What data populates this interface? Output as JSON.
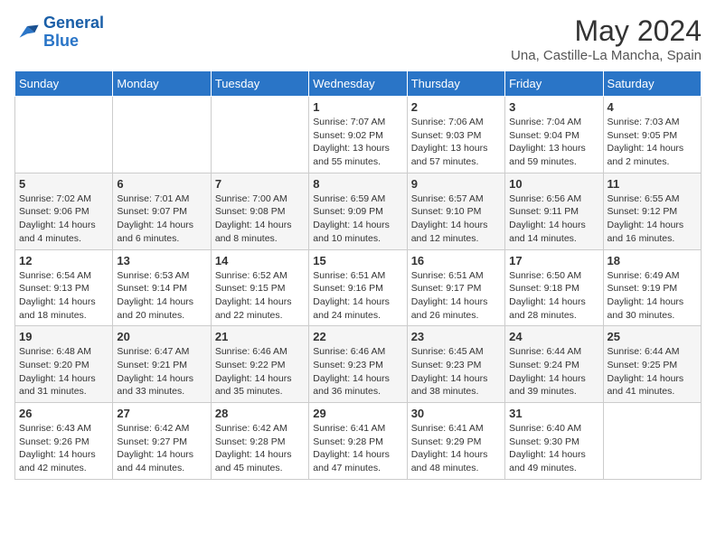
{
  "header": {
    "logo_line1": "General",
    "logo_line2": "Blue",
    "title": "May 2024",
    "subtitle": "Una, Castille-La Mancha, Spain"
  },
  "weekdays": [
    "Sunday",
    "Monday",
    "Tuesday",
    "Wednesday",
    "Thursday",
    "Friday",
    "Saturday"
  ],
  "weeks": [
    [
      {
        "day": "",
        "info": ""
      },
      {
        "day": "",
        "info": ""
      },
      {
        "day": "",
        "info": ""
      },
      {
        "day": "1",
        "info": "Sunrise: 7:07 AM\nSunset: 9:02 PM\nDaylight: 13 hours\nand 55 minutes."
      },
      {
        "day": "2",
        "info": "Sunrise: 7:06 AM\nSunset: 9:03 PM\nDaylight: 13 hours\nand 57 minutes."
      },
      {
        "day": "3",
        "info": "Sunrise: 7:04 AM\nSunset: 9:04 PM\nDaylight: 13 hours\nand 59 minutes."
      },
      {
        "day": "4",
        "info": "Sunrise: 7:03 AM\nSunset: 9:05 PM\nDaylight: 14 hours\nand 2 minutes."
      }
    ],
    [
      {
        "day": "5",
        "info": "Sunrise: 7:02 AM\nSunset: 9:06 PM\nDaylight: 14 hours\nand 4 minutes."
      },
      {
        "day": "6",
        "info": "Sunrise: 7:01 AM\nSunset: 9:07 PM\nDaylight: 14 hours\nand 6 minutes."
      },
      {
        "day": "7",
        "info": "Sunrise: 7:00 AM\nSunset: 9:08 PM\nDaylight: 14 hours\nand 8 minutes."
      },
      {
        "day": "8",
        "info": "Sunrise: 6:59 AM\nSunset: 9:09 PM\nDaylight: 14 hours\nand 10 minutes."
      },
      {
        "day": "9",
        "info": "Sunrise: 6:57 AM\nSunset: 9:10 PM\nDaylight: 14 hours\nand 12 minutes."
      },
      {
        "day": "10",
        "info": "Sunrise: 6:56 AM\nSunset: 9:11 PM\nDaylight: 14 hours\nand 14 minutes."
      },
      {
        "day": "11",
        "info": "Sunrise: 6:55 AM\nSunset: 9:12 PM\nDaylight: 14 hours\nand 16 minutes."
      }
    ],
    [
      {
        "day": "12",
        "info": "Sunrise: 6:54 AM\nSunset: 9:13 PM\nDaylight: 14 hours\nand 18 minutes."
      },
      {
        "day": "13",
        "info": "Sunrise: 6:53 AM\nSunset: 9:14 PM\nDaylight: 14 hours\nand 20 minutes."
      },
      {
        "day": "14",
        "info": "Sunrise: 6:52 AM\nSunset: 9:15 PM\nDaylight: 14 hours\nand 22 minutes."
      },
      {
        "day": "15",
        "info": "Sunrise: 6:51 AM\nSunset: 9:16 PM\nDaylight: 14 hours\nand 24 minutes."
      },
      {
        "day": "16",
        "info": "Sunrise: 6:51 AM\nSunset: 9:17 PM\nDaylight: 14 hours\nand 26 minutes."
      },
      {
        "day": "17",
        "info": "Sunrise: 6:50 AM\nSunset: 9:18 PM\nDaylight: 14 hours\nand 28 minutes."
      },
      {
        "day": "18",
        "info": "Sunrise: 6:49 AM\nSunset: 9:19 PM\nDaylight: 14 hours\nand 30 minutes."
      }
    ],
    [
      {
        "day": "19",
        "info": "Sunrise: 6:48 AM\nSunset: 9:20 PM\nDaylight: 14 hours\nand 31 minutes."
      },
      {
        "day": "20",
        "info": "Sunrise: 6:47 AM\nSunset: 9:21 PM\nDaylight: 14 hours\nand 33 minutes."
      },
      {
        "day": "21",
        "info": "Sunrise: 6:46 AM\nSunset: 9:22 PM\nDaylight: 14 hours\nand 35 minutes."
      },
      {
        "day": "22",
        "info": "Sunrise: 6:46 AM\nSunset: 9:23 PM\nDaylight: 14 hours\nand 36 minutes."
      },
      {
        "day": "23",
        "info": "Sunrise: 6:45 AM\nSunset: 9:23 PM\nDaylight: 14 hours\nand 38 minutes."
      },
      {
        "day": "24",
        "info": "Sunrise: 6:44 AM\nSunset: 9:24 PM\nDaylight: 14 hours\nand 39 minutes."
      },
      {
        "day": "25",
        "info": "Sunrise: 6:44 AM\nSunset: 9:25 PM\nDaylight: 14 hours\nand 41 minutes."
      }
    ],
    [
      {
        "day": "26",
        "info": "Sunrise: 6:43 AM\nSunset: 9:26 PM\nDaylight: 14 hours\nand 42 minutes."
      },
      {
        "day": "27",
        "info": "Sunrise: 6:42 AM\nSunset: 9:27 PM\nDaylight: 14 hours\nand 44 minutes."
      },
      {
        "day": "28",
        "info": "Sunrise: 6:42 AM\nSunset: 9:28 PM\nDaylight: 14 hours\nand 45 minutes."
      },
      {
        "day": "29",
        "info": "Sunrise: 6:41 AM\nSunset: 9:28 PM\nDaylight: 14 hours\nand 47 minutes."
      },
      {
        "day": "30",
        "info": "Sunrise: 6:41 AM\nSunset: 9:29 PM\nDaylight: 14 hours\nand 48 minutes."
      },
      {
        "day": "31",
        "info": "Sunrise: 6:40 AM\nSunset: 9:30 PM\nDaylight: 14 hours\nand 49 minutes."
      },
      {
        "day": "",
        "info": ""
      }
    ]
  ]
}
